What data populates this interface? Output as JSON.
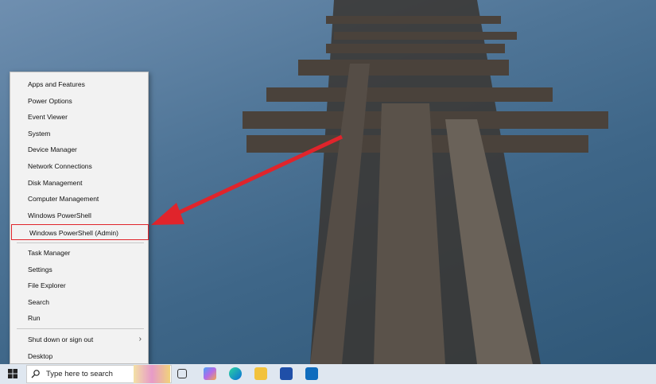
{
  "menu": {
    "items": [
      {
        "label": "Apps and Features"
      },
      {
        "label": "Power Options"
      },
      {
        "label": "Event Viewer"
      },
      {
        "label": "System"
      },
      {
        "label": "Device Manager"
      },
      {
        "label": "Network Connections"
      },
      {
        "label": "Disk Management"
      },
      {
        "label": "Computer Management"
      },
      {
        "label": "Windows PowerShell"
      },
      {
        "label": "Windows PowerShell (Admin)",
        "highlighted": true
      },
      {
        "label": "Task Manager"
      },
      {
        "label": "Settings"
      },
      {
        "label": "File Explorer"
      },
      {
        "label": "Search"
      },
      {
        "label": "Run"
      },
      {
        "label": "Shut down or sign out",
        "submenu": true
      },
      {
        "label": "Desktop"
      }
    ]
  },
  "taskbar": {
    "search_placeholder": "Type here to search",
    "apps": [
      "task-view",
      "copilot",
      "edge",
      "file-explorer",
      "microsoft-store",
      "outlook"
    ]
  },
  "colors": {
    "highlight": "#e0242b",
    "arrow": "#e0242b"
  }
}
